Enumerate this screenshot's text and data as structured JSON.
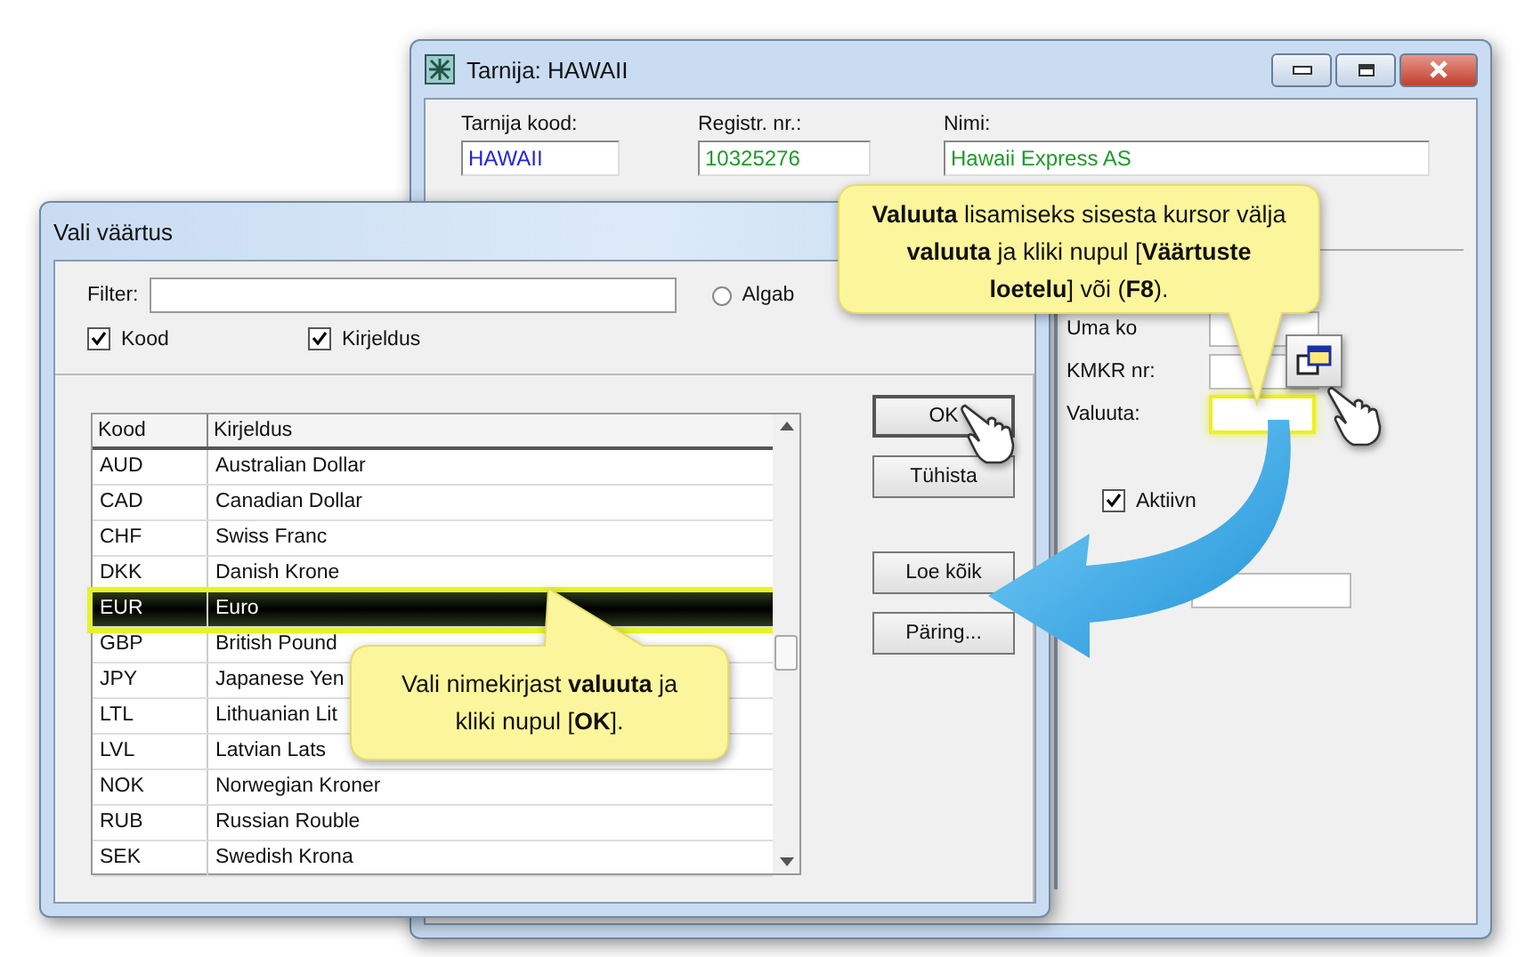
{
  "back_window": {
    "title": "Tarnija: HAWAII",
    "fields": [
      {
        "label": "Tarnija kood:",
        "value": "HAWAII",
        "color": "#2424e8"
      },
      {
        "label": "Registr. nr.:",
        "value": "10325276",
        "color": "#1f9a2a"
      },
      {
        "label": "Nimi:",
        "value": "Hawaii Express AS",
        "color": "#1f9a2a"
      }
    ],
    "group_fields": [
      {
        "label": "Uma ko",
        "highlighted": false
      },
      {
        "label": "KMKR nr:",
        "highlighted": false
      },
      {
        "label": "Valuuta:",
        "highlighted": true
      }
    ],
    "checkbox": {
      "label": "Aktiivn",
      "checked": true
    }
  },
  "dialog": {
    "title": "Vali väärtus",
    "filter": {
      "label": "Filter:"
    },
    "radio": {
      "label": "Algab",
      "selected": false
    },
    "checkboxes": [
      {
        "label": "Kood",
        "checked": true
      },
      {
        "label": "Kirjeldus",
        "checked": true
      }
    ],
    "table": {
      "columns": [
        "Kood",
        "Kirjeldus"
      ],
      "rows": [
        {
          "cells": [
            "AUD",
            "Australian Dollar"
          ],
          "selected": false
        },
        {
          "cells": [
            "CAD",
            "Canadian Dollar"
          ],
          "selected": false
        },
        {
          "cells": [
            "CHF",
            "Swiss Franc"
          ],
          "selected": false
        },
        {
          "cells": [
            "DKK",
            "Danish Krone"
          ],
          "selected": false
        },
        {
          "cells": [
            "EUR",
            "Euro"
          ],
          "selected": true
        },
        {
          "cells": [
            "GBP",
            "British Pound"
          ],
          "selected": false
        },
        {
          "cells": [
            "JPY",
            "Japanese Yen"
          ],
          "selected": false
        },
        {
          "cells": [
            "LTL",
            "Lithuanian Lit"
          ],
          "selected": false
        },
        {
          "cells": [
            "LVL",
            "Latvian Lats"
          ],
          "selected": false
        },
        {
          "cells": [
            "NOK",
            "Norwegian Kroner"
          ],
          "selected": false
        },
        {
          "cells": [
            "RUB",
            "Russian Rouble"
          ],
          "selected": false
        },
        {
          "cells": [
            "SEK",
            "Swedish Krona"
          ],
          "selected": false
        }
      ]
    },
    "buttons": [
      "OK",
      "Tühista",
      "Loe kõik",
      "Päring..."
    ]
  },
  "callouts": [
    "**Valuuta** lisamiseks sisesta kursor välja **valuuta** ja kliki nupul [**Väärtuste loetelu**] või (**F8**).",
    "Vali nimekirjast **valuuta** ja kliki nupul [**OK**]."
  ]
}
